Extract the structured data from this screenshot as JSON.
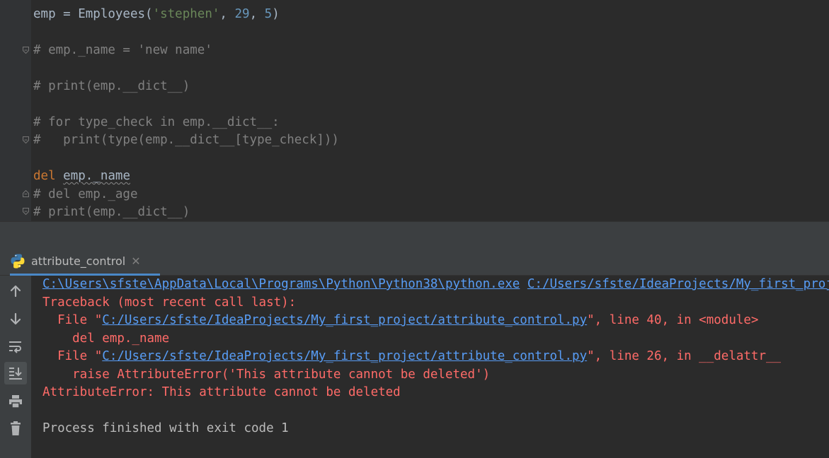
{
  "editor": {
    "lines": [
      {
        "parts": [
          [
            "plain",
            "emp = Employees("
          ],
          [
            "string",
            "'stephen'"
          ],
          [
            "plain",
            ", "
          ],
          [
            "number",
            "29"
          ],
          [
            "plain",
            ", "
          ],
          [
            "number",
            "5"
          ],
          [
            "plain",
            ")"
          ]
        ]
      },
      {
        "parts": [
          [
            "comment",
            "# emp._name = 'new name'"
          ]
        ]
      },
      {
        "parts": [
          [
            "comment",
            "# print(emp.__dict__)"
          ]
        ]
      },
      {
        "parts": [
          [
            "comment",
            "# for type_check in emp.__dict__:"
          ]
        ]
      },
      {
        "parts": [
          [
            "comment",
            "#   print(type(emp.__dict__[type_check]))"
          ]
        ]
      },
      {
        "parts": [
          [
            "keyword",
            "del"
          ],
          [
            "plain",
            " "
          ],
          [
            "squiggle",
            "emp._name"
          ]
        ]
      },
      {
        "parts": [
          [
            "comment",
            "# del emp._age"
          ]
        ]
      },
      {
        "parts": [
          [
            "comment",
            "# print(emp.__dict__)"
          ]
        ]
      }
    ]
  },
  "run_window": {
    "tab_label": "attribute_control",
    "tab_icon": "python-icon",
    "close_icon": "close-icon",
    "toolbar": [
      {
        "name": "scroll-up-icon",
        "label": "up"
      },
      {
        "name": "scroll-down-icon",
        "label": "down"
      },
      {
        "name": "soft-wrap-icon",
        "label": "soft wrap"
      },
      {
        "name": "scroll-to-end-icon",
        "label": "scroll to end"
      },
      {
        "name": "print-icon",
        "label": "print"
      },
      {
        "name": "trash-icon",
        "label": "clear"
      }
    ]
  },
  "console": {
    "python_exe": "C:\\Users\\sfste\\AppData\\Local\\Programs\\Python\\Python38\\python.exe",
    "script_path": "C:/Users/sfste/IdeaProjects/My_first_project/attribute_control.py",
    "traceback_header": "Traceback (most recent call last):",
    "frame1_prefix": "  File \"",
    "frame1_file": "C:/Users/sfste/IdeaProjects/My_first_project/attribute_control.py",
    "frame1_suffix": "\", line 40, in <module>",
    "frame1_code": "    del emp._name",
    "frame2_prefix": "  File \"",
    "frame2_file": "C:/Users/sfste/IdeaProjects/My_first_project/attribute_control.py",
    "frame2_suffix": "\", line 26, in __delattr__",
    "frame2_code": "    raise AttributeError('This attribute cannot be deleted')",
    "error_line": "AttributeError: This attribute cannot be deleted",
    "exit_line": "Process finished with exit code 1"
  },
  "colors": {
    "editor_bg": "#2b2b2b",
    "comment": "#808080",
    "keyword": "#cc7832",
    "string": "#6a8759",
    "number": "#6897bb",
    "error_text": "#ff6b68",
    "link": "#589df6"
  }
}
